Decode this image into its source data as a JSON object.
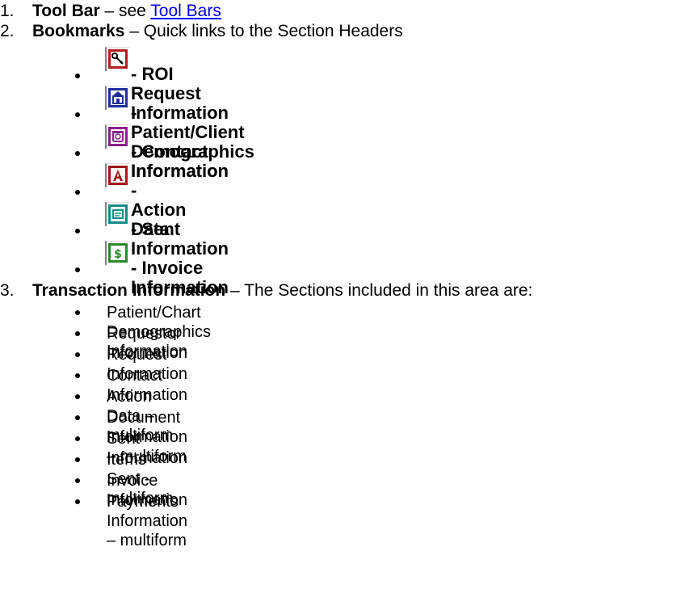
{
  "items": [
    {
      "number": "1.",
      "title": "Tool Bar",
      "sep": " – see ",
      "link": "Tool Bars"
    },
    {
      "number": "2.",
      "title": "Bookmarks",
      "desc": " – Quick links to the Section Headers"
    },
    {
      "number": "3.",
      "title": "Transaction Information",
      "desc": " – The Sections included in this area are:"
    }
  ],
  "bookmarks": [
    {
      "icon": "key-icon",
      "color": "#b0201f",
      "label": "- ROI Request Information"
    },
    {
      "icon": "house-icon",
      "color": "#1f2f9a",
      "label": "- Patient/Client Demographics Information"
    },
    {
      "icon": "phone-icon",
      "color": "#8a1f8a",
      "label": "- Contact Information"
    },
    {
      "icon": "letter-a-icon",
      "color": "#a01818",
      "label": "- Action Data"
    },
    {
      "icon": "envelope-icon",
      "color": "#1a8a8a",
      "label": "- Sent Information"
    },
    {
      "icon": "dollar-icon",
      "color": "#2a8a2a",
      "label": "- Invoice Information"
    }
  ],
  "sections": [
    "Patient/Chart Demographics Information",
    "Requestor Information",
    "Request Information",
    "Contact Information",
    "Action Data – multiform",
    "Document Information – multiform",
    "Sent Information",
    "Items Sent - multiform",
    "Invoice Information",
    "Payments Information – multiform"
  ]
}
